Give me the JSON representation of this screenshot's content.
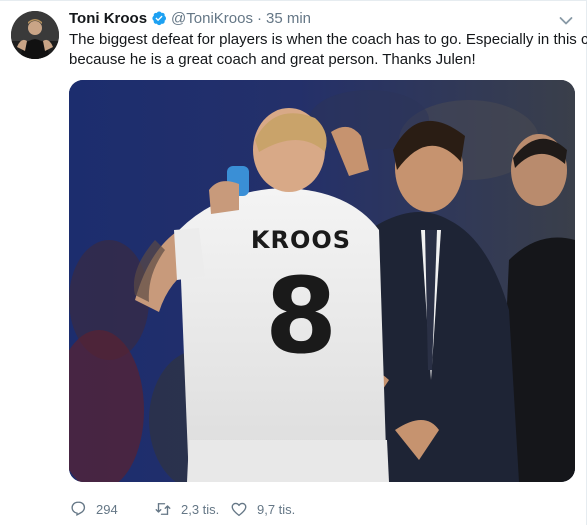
{
  "tweet": {
    "author_name": "Toni Kroos",
    "handle": "@ToniKroos",
    "separator": "·",
    "time": "35 min",
    "text_lines": [
      "The biggest defeat for players is when the coach has to go. Especially in this case",
      "because he is a great coach and great person. Thanks Julen!"
    ],
    "photo": {
      "shirt_name": "KROOS",
      "shirt_number": "8"
    },
    "actions": {
      "reply_count": "294",
      "retweet_count": "2,3 tis.",
      "like_count": "9,7 tis."
    }
  },
  "icons": {
    "verified": "verified-badge-icon",
    "caret": "chevron-down-icon",
    "reply": "reply-icon",
    "retweet": "retweet-icon",
    "like": "heart-icon"
  },
  "colors": {
    "text": "#14171a",
    "secondary": "#657786",
    "verified": "#1da1f2",
    "border": "#e6ecf0"
  }
}
